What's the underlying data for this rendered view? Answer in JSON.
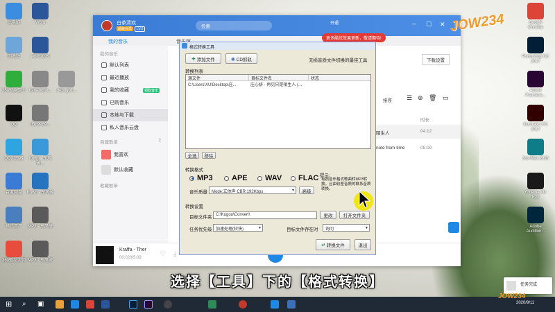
{
  "desktop_icons": [
    {
      "label": "此电脑",
      "color": "#3b8de0",
      "col": 0,
      "row": 0
    },
    {
      "label": "回收站",
      "color": "#6ea6d9",
      "col": 0,
      "row": 1
    },
    {
      "label": "360安全卫士",
      "color": "#2fae3b",
      "col": 0,
      "row": 2
    },
    {
      "label": "QQ",
      "color": "#111111",
      "col": 0,
      "row": 3
    },
    {
      "label": "QQ浏览器",
      "color": "#2ea5e0",
      "col": 0,
      "row": 4
    },
    {
      "label": "百度网盘",
      "color": "#3a7bd5",
      "col": 0,
      "row": 5
    },
    {
      "label": "格式工厂",
      "color": "#4a7fbf",
      "col": 0,
      "row": 6
    },
    {
      "label": "360驱动大师",
      "color": "#e74c3c",
      "col": 0,
      "row": 7
    },
    {
      "label": "Word",
      "color": "#2b579a",
      "col": 1,
      "row": 0
    },
    {
      "label": "word2019",
      "color": "#2b579a",
      "col": 1,
      "row": 1
    },
    {
      "label": "bare-bone...",
      "color": "#888888",
      "col": 1,
      "row": 2
    },
    {
      "label": "d3d9989...",
      "color": "#777777",
      "col": 1,
      "row": 3
    },
    {
      "label": "Kuwo - 东风破...",
      "color": "#3a9ad9",
      "col": 1,
      "row": 4
    },
    {
      "label": "Kuwo - 东风破",
      "color": "#2474c0",
      "col": 1,
      "row": 5
    },
    {
      "label": "MP3 - 东风破",
      "color": "#5a5a5a",
      "col": 1,
      "row": 6
    },
    {
      "label": "MP3 - 东风破",
      "color": "#5a5a5a",
      "col": 1,
      "row": 7
    },
    {
      "label": "debug01...",
      "color": "#999999",
      "col": 2,
      "row": 2
    },
    {
      "label": "Google Chrome",
      "color": "#db4437",
      "col": 3,
      "row": 0
    },
    {
      "label": "Photoshop CC 2017",
      "color": "#001e36",
      "col": 3,
      "row": 1
    },
    {
      "label": "Adobe Premiere...",
      "color": "#2a0634",
      "col": 3,
      "row": 2
    },
    {
      "label": "Illustrator CC 2017",
      "color": "#330000",
      "col": 3,
      "row": 3
    },
    {
      "label": "3ds Max 2015",
      "color": "#0f7c8a",
      "col": 3,
      "row": 4
    },
    {
      "label": "Cinema 4D R20",
      "color": "#1a1a1a",
      "col": 3,
      "row": 5
    },
    {
      "label": "Adobe Audition...",
      "color": "#00263d",
      "col": 3,
      "row": 6
    }
  ],
  "app": {
    "user_name": "白茶清欢",
    "badge": "超级会员",
    "level": "LV.6",
    "search_placeholder": "任意",
    "nav_tabs": [
      "我的音乐",
      "音乐馆"
    ],
    "toast": "更多酷炫效果更新，敬请期待!",
    "sidebar": {
      "section_my": "我的音乐",
      "items": [
        "默认列表",
        "最近播放",
        "我的收藏",
        "已购音乐",
        "本地与下载",
        "私人音乐云盘"
      ],
      "favorite_badge": "领取音乐",
      "section_created": "自建歌单",
      "created_count": "2",
      "created_items": [
        "我喜欢",
        "默认收藏"
      ],
      "section_collected": "收藏歌单"
    },
    "right_panel": {
      "download_settings": "下载设置",
      "sort": "排序",
      "duration_header": "时长",
      "rows": [
        {
          "title": "陌生人",
          "duration": "04:12"
        },
        {
          "title": "note from time",
          "duration": "05:09"
        }
      ]
    },
    "player": {
      "track": "Kraffa - Ther",
      "time": "00:02/05:09"
    }
  },
  "converter": {
    "title": "格式转换工具",
    "add_file": "添加文件",
    "cd_rip": "CD抓轨",
    "slogan": "无损音质文件切换的最佳工具",
    "list_label": "转换列表",
    "columns": [
      "源文件",
      "目标文件名",
      "状态"
    ],
    "rows": [
      {
        "src": "C:\\Users\\XU\\Desktop\\庄...",
        "target": "庄心妍 - 再见只是陌生人 (...",
        "status": ""
      }
    ],
    "select_all": "全选",
    "remove": "移除",
    "format_label": "转换格式",
    "formats": [
      {
        "name": "MP3",
        "selected": true
      },
      {
        "name": "APE",
        "selected": false
      },
      {
        "name": "WAV",
        "selected": false
      },
      {
        "name": "FLAC",
        "selected": false
      }
    ],
    "quality_label": "音乐质量",
    "quality_value": "Mode:立体声  CBR:192Kbps",
    "advanced": "高级",
    "tip_title": "提示:",
    "tip_text": "有损音乐格式歌曲转MP3转换，且由较差音质的联系音质转换。",
    "settings_label": "转换设置",
    "target_folder_label": "目标文件夹",
    "target_folder_value": "C:\\Kugou\\Convert\\",
    "change": "更改",
    "open_folder": "打开文件夹",
    "priority_label": "任务优先级",
    "priority_value": "加速处理(较快)",
    "exists_label": "目标文件存在时",
    "exists_value": "询问",
    "convert_btn": "转换文件",
    "exit_btn": "退出"
  },
  "subtitle": "选择【工具】下的【格式转换】",
  "watermark": "JOW234",
  "taskbar": {
    "notification": "任务完成",
    "time": "2020/9/11"
  }
}
